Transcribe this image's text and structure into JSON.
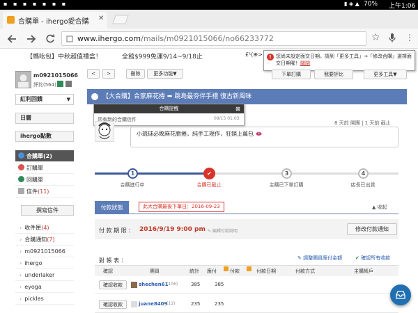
{
  "statusbar": {
    "battery": "70%",
    "time": "上午1:06"
  },
  "browser": {
    "tab_title": "合購單 - ihergo愛合購",
    "tab_close": "✕",
    "url_domain": "www.ihergo.com",
    "url_path": "/mails/m0921015066/no66233772"
  },
  "banner": {
    "left_text": "【螞吆包】中秋超值禮盒！",
    "mid_text": "全館$999免運9/14~9/18止",
    "right_snippet": "£¹(⊕>"
  },
  "warning": {
    "text": "您尚未設定面交日期，請到「更多工具」→「修改合購」選擇面交日期喔！",
    "link": "關閉"
  },
  "user": {
    "name": "m0921015066",
    "rating": "評比(564)"
  },
  "sidebar": {
    "select_label": "紅利回饋",
    "calendar": "日曆",
    "points": "ihergo點數",
    "items": [
      {
        "label": "合購單",
        "count": "(2)",
        "color": "#4a90d9"
      },
      {
        "label": "訂購單",
        "count": "",
        "color": "#d9534f"
      },
      {
        "label": "回購單",
        "count": "",
        "color": "#2e8b57"
      },
      {
        "label": "信件",
        "count": "(11)",
        "color": "#999"
      }
    ],
    "compose": "撰寫信件",
    "sublist": [
      {
        "label": "收件匣",
        "count": "(4)"
      },
      {
        "label": "合購通知",
        "count": "(7)"
      },
      {
        "label": "m0921015066",
        "count": ""
      },
      {
        "label": "ihergo",
        "count": ""
      },
      {
        "label": "underlaker",
        "count": ""
      },
      {
        "label": "eyoga",
        "count": ""
      },
      {
        "label": "pickles",
        "count": ""
      }
    ]
  },
  "toolbar": {
    "prev": "<",
    "next": ">",
    "delete": "刪除",
    "more_actions": "更多功能▼",
    "order": "下單訂購",
    "review": "我要評比",
    "more_tools": "更多工具▼"
  },
  "panel": {
    "title": "【大合購】合家麻花捲 ➡ 跳島最夯伴手禮 復古新風味",
    "popup_title": "合購提醒",
    "popup_text": "您有新的合購信件",
    "popup_time": "09/15 01:03",
    "message": "小琉球必敗麻花脆捲，純手工現作，狂銷上萬包 👄",
    "meta": "8 天前 開團 | 1 天前 截止"
  },
  "steps": [
    {
      "num": "1",
      "label": "合購進行中"
    },
    {
      "num": "✔",
      "label": "合購已截止"
    },
    {
      "num": "3",
      "label": "主購已下單訂購"
    },
    {
      "num": "4",
      "label": "店長已出貨"
    }
  ],
  "payment": {
    "tab": "付款狀態",
    "deadline_note": "此大合購最後下單日：2016-09-23",
    "collapse": "▲ 收起",
    "deadline_label": "付 款 期 限 ：",
    "deadline_value": "2016/9/19  9:00 pm",
    "edit_link": "✎ 編輯付款說明",
    "notify_button": "修改付款通知"
  },
  "account": {
    "title": "對 帳 表 ：",
    "adjust": "調整團員應付金額",
    "confirm_all": "確認所有收款",
    "headers": [
      "確認",
      "團員",
      "統計",
      "應付",
      "付款",
      "付款日期",
      "付款方式",
      "主購帳戶"
    ],
    "rows": [
      {
        "confirm": "確認收款",
        "member": "shechen61",
        "score": "(106)",
        "total": "385",
        "due": "385"
      },
      {
        "confirm": "確認收款",
        "member": "juane8409",
        "score": "(11)",
        "total": "235",
        "due": "235"
      }
    ]
  }
}
